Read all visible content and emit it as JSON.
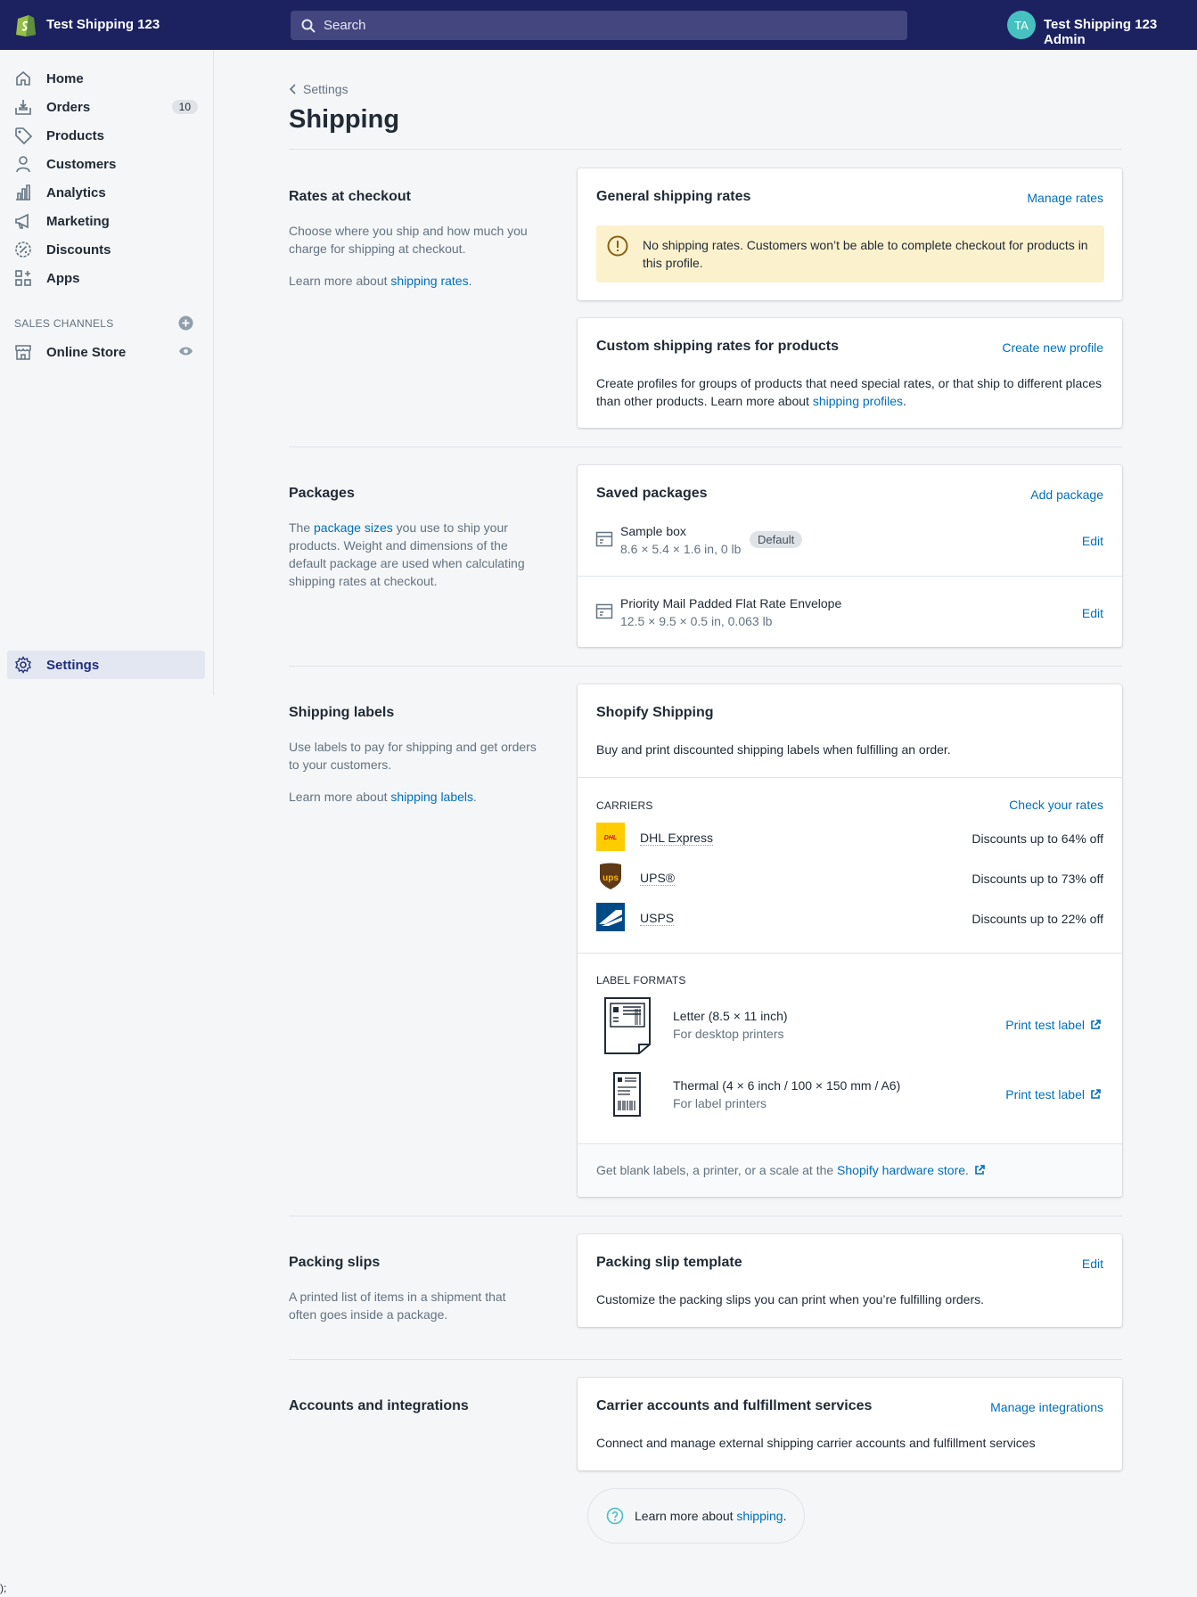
{
  "topbar": {
    "shop_name": "Test Shipping 123",
    "search_placeholder": "Search",
    "avatar_initials": "TA",
    "admin_name": "Test Shipping 123 Admin",
    "bg_color": "#1c2260"
  },
  "sidebar": {
    "items": [
      {
        "label": "Home",
        "icon": "home-icon"
      },
      {
        "label": "Orders",
        "icon": "orders-icon",
        "badge": "10"
      },
      {
        "label": "Products",
        "icon": "tag-icon"
      },
      {
        "label": "Customers",
        "icon": "person-icon"
      },
      {
        "label": "Analytics",
        "icon": "bar-chart-icon"
      },
      {
        "label": "Marketing",
        "icon": "megaphone-icon"
      },
      {
        "label": "Discounts",
        "icon": "discount-icon"
      },
      {
        "label": "Apps",
        "icon": "apps-icon"
      }
    ],
    "sales_channels_title": "SALES CHANNELS",
    "online_store": "Online Store",
    "settings": "Settings"
  },
  "page": {
    "breadcrumb": "Settings",
    "title": "Shipping"
  },
  "rates": {
    "title": "Rates at checkout",
    "desc": "Choose where you ship and how much you charge for shipping at checkout.",
    "learn_prefix": "Learn more about ",
    "learn_link": "shipping rates",
    "general_title": "General shipping rates",
    "general_action": "Manage rates",
    "warning": "No shipping rates. Customers won’t be able to complete checkout for products in this profile.",
    "custom_title": "Custom shipping rates for products",
    "custom_action": "Create new profile",
    "custom_text": "Create profiles for groups of products that need special rates, or that ship to different places than other products. Learn more about ",
    "custom_link": "shipping profiles"
  },
  "packages": {
    "title": "Packages",
    "desc_prefix": "The ",
    "desc_link": "package sizes",
    "desc_rest": " you use to ship your products. Weight and dimensions of the default package are used when calculating shipping rates at checkout.",
    "card_title": "Saved packages",
    "card_action": "Add package",
    "items": [
      {
        "name": "Sample box",
        "dims": "8.6 × 5.4 × 1.6 in, 0 lb",
        "badge": "Default",
        "action": "Edit"
      },
      {
        "name": "Priority Mail Padded Flat Rate Envelope",
        "dims": "12.5 × 9.5 × 0.5 in, 0.063 lb",
        "action": "Edit"
      }
    ]
  },
  "labels": {
    "title": "Shipping labels",
    "desc": "Use labels to pay for shipping and get orders to your customers.",
    "learn_prefix": "Learn more about ",
    "learn_link": "shipping labels",
    "card_title": "Shopify Shipping",
    "card_text": "Buy and print discounted shipping labels when fulfilling an order.",
    "carriers_title": "CARRIERS",
    "carriers_action": "Check your rates",
    "carriers": [
      {
        "name": "DHL Express",
        "discount": "Discounts up to 64% off",
        "logo_color": "#ffcc00"
      },
      {
        "name": "UPS®",
        "discount": "Discounts up to 73% off",
        "logo_color": "#5f3a17"
      },
      {
        "name": "USPS",
        "discount": "Discounts up to 22% off",
        "logo_color": "#004b87"
      }
    ],
    "formats_title": "LABEL FORMATS",
    "formats": [
      {
        "name": "Letter (8.5 × 11 inch)",
        "sub": "For desktop printers",
        "action": "Print test label"
      },
      {
        "name": "Thermal (4 × 6 inch / 100 × 150 mm / A6)",
        "sub": "For label printers",
        "action": "Print test label"
      }
    ],
    "footer_prefix": "Get blank labels, a printer, or a scale at the ",
    "footer_link": "Shopify hardware store."
  },
  "slips": {
    "title": "Packing slips",
    "desc": "A printed list of items in a shipment that often goes inside a package.",
    "card_title": "Packing slip template",
    "card_action": "Edit",
    "card_text": "Customize the packing slips you can print when you’re fulfilling orders."
  },
  "accounts": {
    "title": "Accounts and integrations",
    "card_title": "Carrier accounts and fulfillment services",
    "card_action": "Manage integrations",
    "card_text": "Connect and manage external shipping carrier accounts and fulfillment services"
  },
  "help": {
    "prefix": "Learn more about ",
    "link": "shipping",
    "suffix": "."
  },
  "stray_text": ");"
}
